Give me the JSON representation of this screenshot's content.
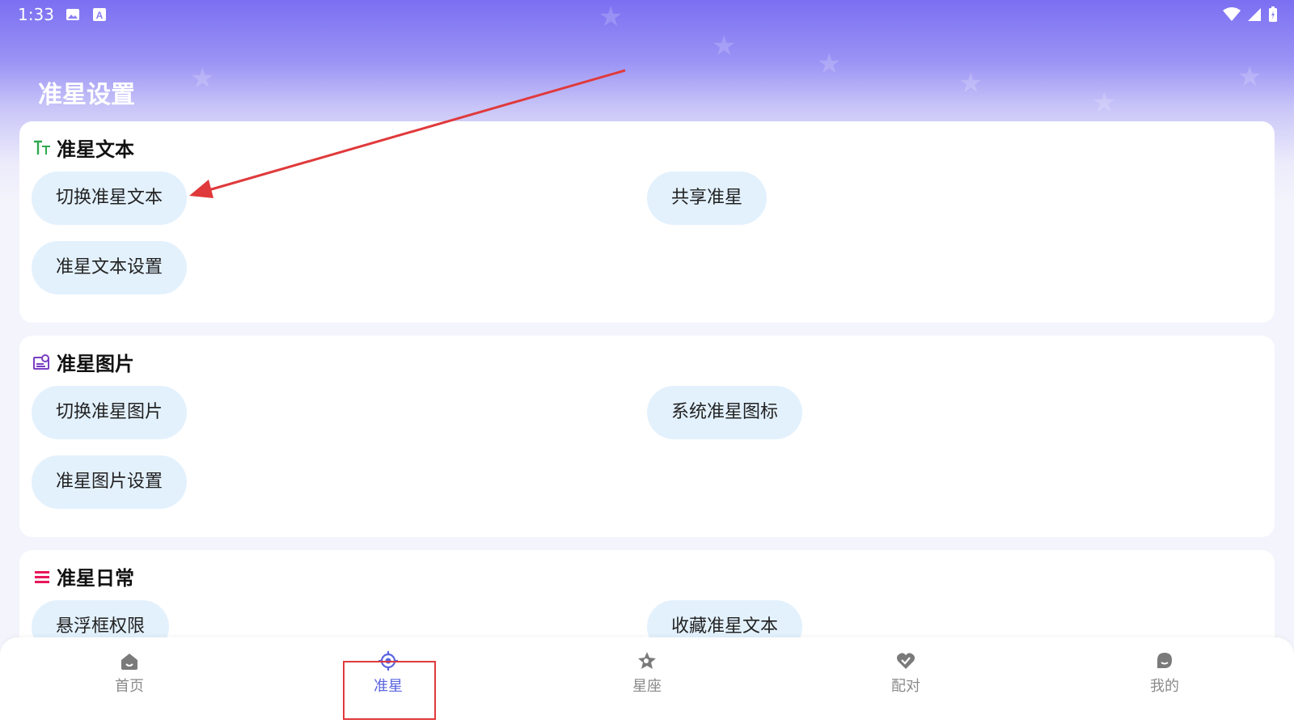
{
  "status_bar": {
    "time": "1:33"
  },
  "page": {
    "title": "准星设置"
  },
  "sections": [
    {
      "title": "准星文本",
      "icon": "text-size-icon",
      "icon_color": "#2fa84f",
      "buttons": [
        "切换准星文本",
        "共享准星",
        "准星文本设置"
      ]
    },
    {
      "title": "准星图片",
      "icon": "image-settings-icon",
      "icon_color": "#7a3fc4",
      "buttons": [
        "切换准星图片",
        "系统准星图标",
        "准星图片设置"
      ]
    },
    {
      "title": "准星日常",
      "icon": "list-icon",
      "icon_color": "#e8185a",
      "buttons": [
        "悬浮框权限",
        "收藏准星文本"
      ]
    }
  ],
  "bottom_nav": {
    "items": [
      {
        "label": "首页",
        "icon": "home-icon"
      },
      {
        "label": "准星",
        "icon": "crosshair-icon",
        "active": true
      },
      {
        "label": "星座",
        "icon": "constellation-icon"
      },
      {
        "label": "配对",
        "icon": "heart-pair-icon"
      },
      {
        "label": "我的",
        "icon": "profile-icon"
      }
    ]
  },
  "colors": {
    "header_top": "#7b6ff2",
    "chip_bg": "#e3f1fd",
    "nav_active": "#5a64e0",
    "annotation_red": "#e0393b"
  }
}
